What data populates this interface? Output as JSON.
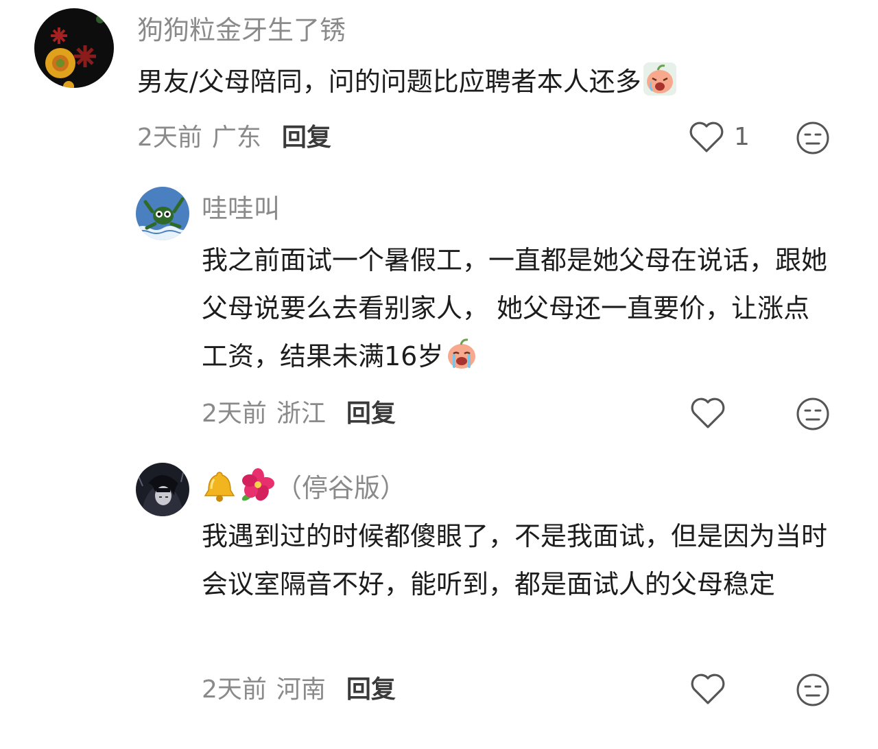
{
  "comments": [
    {
      "username": "狗狗粒金牙生了锈",
      "content": "男友/父母陪同，问的问题比应聘者本人还多",
      "content_emoji": "crying-peach-emoji",
      "time": "2天前",
      "location": "广东",
      "reply_label": "回复",
      "like_count": "1",
      "avatar_icon": "red-flower-avatar"
    },
    {
      "username": "哇哇叫",
      "content": "我之前面试一个暑假工，一直都是她父母在说话，跟她父母说要么去看别家人， 她父母还一直要价，让涨点工资，结果未满16岁",
      "content_emoji": "sobbing-peach-emoji",
      "time": "2天前",
      "location": "浙江",
      "reply_label": "回复",
      "like_count": "",
      "avatar_icon": "frog-avatar"
    },
    {
      "username_emojis": [
        "bell-emoji",
        "hibiscus-emoji"
      ],
      "username": "（停谷版）",
      "content": "我遇到过的时候都傻眼了，不是我面试，但是因为当时会议室隔音不好，能听到，都是面试人的父母稳定",
      "time": "2天前",
      "location": "河南",
      "reply_label": "回复",
      "like_count": "",
      "avatar_icon": "dark-anime-avatar"
    }
  ],
  "colors": {
    "meta_text": "#8a8a8a",
    "username": "#8a8a8a",
    "content": "#1c1c1c",
    "icon_stroke": "#555555"
  }
}
